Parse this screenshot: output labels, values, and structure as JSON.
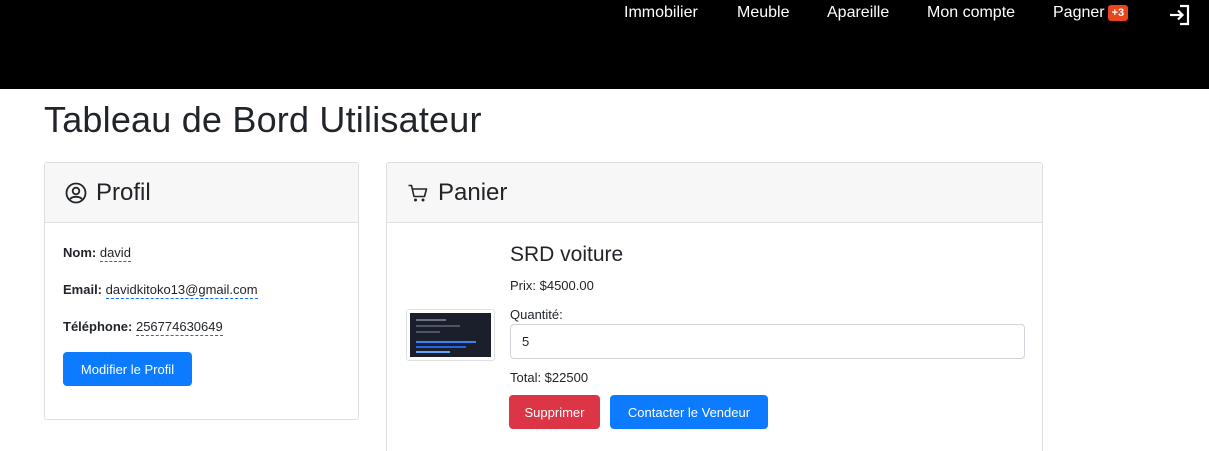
{
  "nav": {
    "items": [
      "Immobilier",
      "Meuble",
      "Apareille",
      "Mon compte"
    ],
    "cart_label": "Pagner",
    "cart_badge": "+3",
    "logout_icon": "logout-icon"
  },
  "page": {
    "title": "Tableau de Bord Utilisateur"
  },
  "profile": {
    "header": "Profil",
    "icon": "user-circle-icon",
    "name_label": "Nom:",
    "name_value": "david",
    "email_label": "Email:",
    "email_value": "davidkitoko13@gmail.com",
    "phone_label": "Téléphone:",
    "phone_value": "256774630649",
    "edit_button": "Modifier le Profil"
  },
  "cart": {
    "header": "Panier",
    "icon": "cart-icon",
    "item": {
      "title": "SRD voiture",
      "price_line": "Prix: $4500.00",
      "quantity_label": "Quantité:",
      "quantity_value": "5",
      "total_line": "Total: $22500",
      "delete_button": "Supprimer",
      "contact_button": "Contacter le Vendeur"
    }
  },
  "colors": {
    "primary": "#0d7bff",
    "danger": "#dc3545",
    "badge": "#e8461f",
    "topbar": "#000000"
  }
}
